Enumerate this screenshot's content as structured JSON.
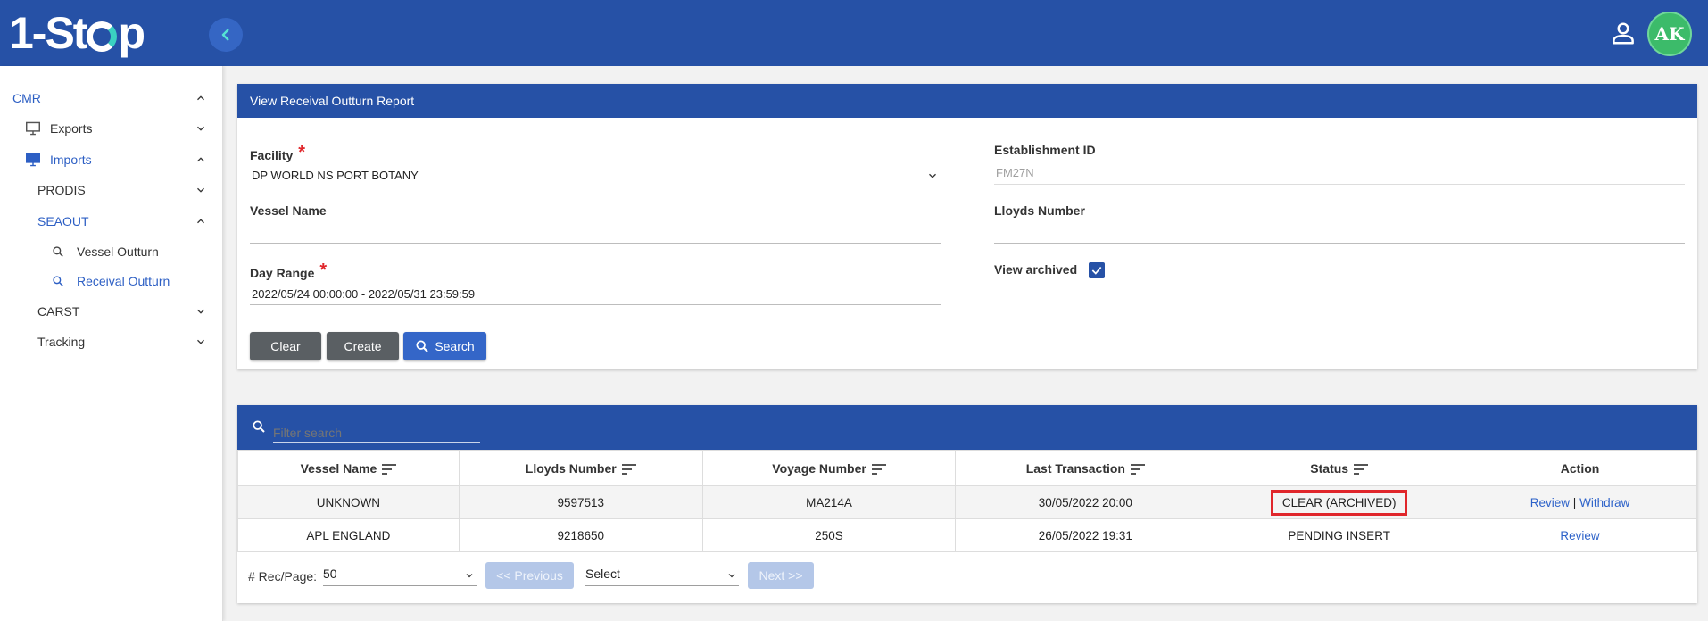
{
  "header": {
    "logo_text_1": "1-St",
    "logo_text_2": "p",
    "avatar_initials": "AK"
  },
  "sidebar": {
    "cmr": "CMR",
    "exports": "Exports",
    "imports": "Imports",
    "prodis": "PRODIS",
    "seaout": "SEAOUT",
    "vessel_outturn": "Vessel Outturn",
    "receival_outturn": "Receival Outturn",
    "carst": "CARST",
    "tracking": "Tracking"
  },
  "form": {
    "title": "View Receival Outturn Report",
    "facility_label": "Facility",
    "facility_value": "DP WORLD NS PORT BOTANY",
    "establishment_label": "Establishment ID",
    "establishment_value": "FM27N",
    "vessel_name_label": "Vessel Name",
    "vessel_name_value": "",
    "lloyds_label": "Lloyds Number",
    "lloyds_value": "",
    "day_range_label": "Day Range",
    "day_range_value": "2022/05/24 00:00:00 - 2022/05/31 23:59:59",
    "view_archived_label": "View archived",
    "view_archived_checked": true,
    "required_marker": "*",
    "clear_button": "Clear",
    "create_button": "Create",
    "search_button": "Search"
  },
  "results": {
    "filter_placeholder": "Filter search",
    "columns": [
      "Vessel Name",
      "Lloyds Number",
      "Voyage Number",
      "Last Transaction",
      "Status",
      "Action"
    ],
    "rows": [
      {
        "vessel": "UNKNOWN",
        "lloyds": "9597513",
        "voyage": "MA214A",
        "last_tx": "30/05/2022 20:00",
        "status": "CLEAR (ARCHIVED)",
        "action_review": "Review",
        "action_sep": "|",
        "action_withdraw": "Withdraw"
      },
      {
        "vessel": "APL ENGLAND",
        "lloyds": "9218650",
        "voyage": "250S",
        "last_tx": "26/05/2022 19:31",
        "status": "PENDING INSERT",
        "action_review": "Review"
      }
    ],
    "pagination": {
      "rec_label": "# Rec/Page:",
      "rec_value": "50",
      "prev_button": "<< Previous",
      "page_select": "Select",
      "next_button": "Next >>"
    }
  },
  "colors": {
    "primary": "#2651a6",
    "accent": "#3ad1c1",
    "status_highlight": "#e0262b",
    "link": "#2d62c9"
  }
}
